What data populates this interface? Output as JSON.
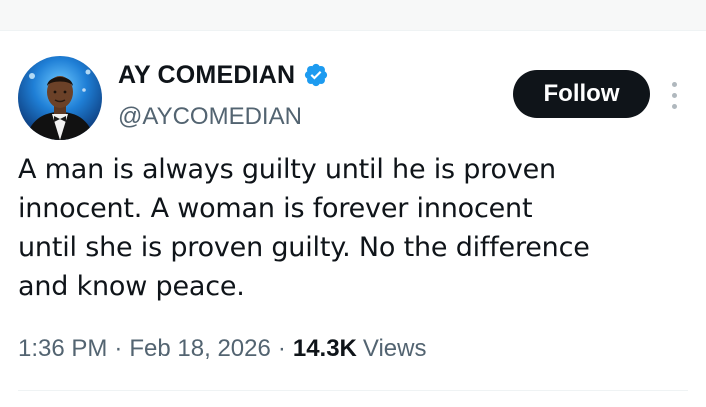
{
  "author": {
    "name": "AY COMEDIAN",
    "handle": "@AYCOMEDIAN",
    "verified_icon": "verified-badge-icon",
    "verified_color": "#1d9bf0"
  },
  "actions": {
    "follow_label": "Follow",
    "more_icon": "more-vertical-icon"
  },
  "tweet": {
    "text": "A man is always guilty until he is proven\ninnocent. A woman is forever innocent\nuntil she is proven guilty. No the difference\nand know peace."
  },
  "meta": {
    "time": "1:36 PM",
    "separator": "·",
    "date": "Feb 18, 2026",
    "views_count": "14.3K",
    "views_label": "Views"
  },
  "colors": {
    "text_primary": "#0f1419",
    "text_secondary": "#536471",
    "follow_bg": "#0f1419",
    "follow_text": "#ffffff",
    "accent": "#1d9bf0"
  }
}
